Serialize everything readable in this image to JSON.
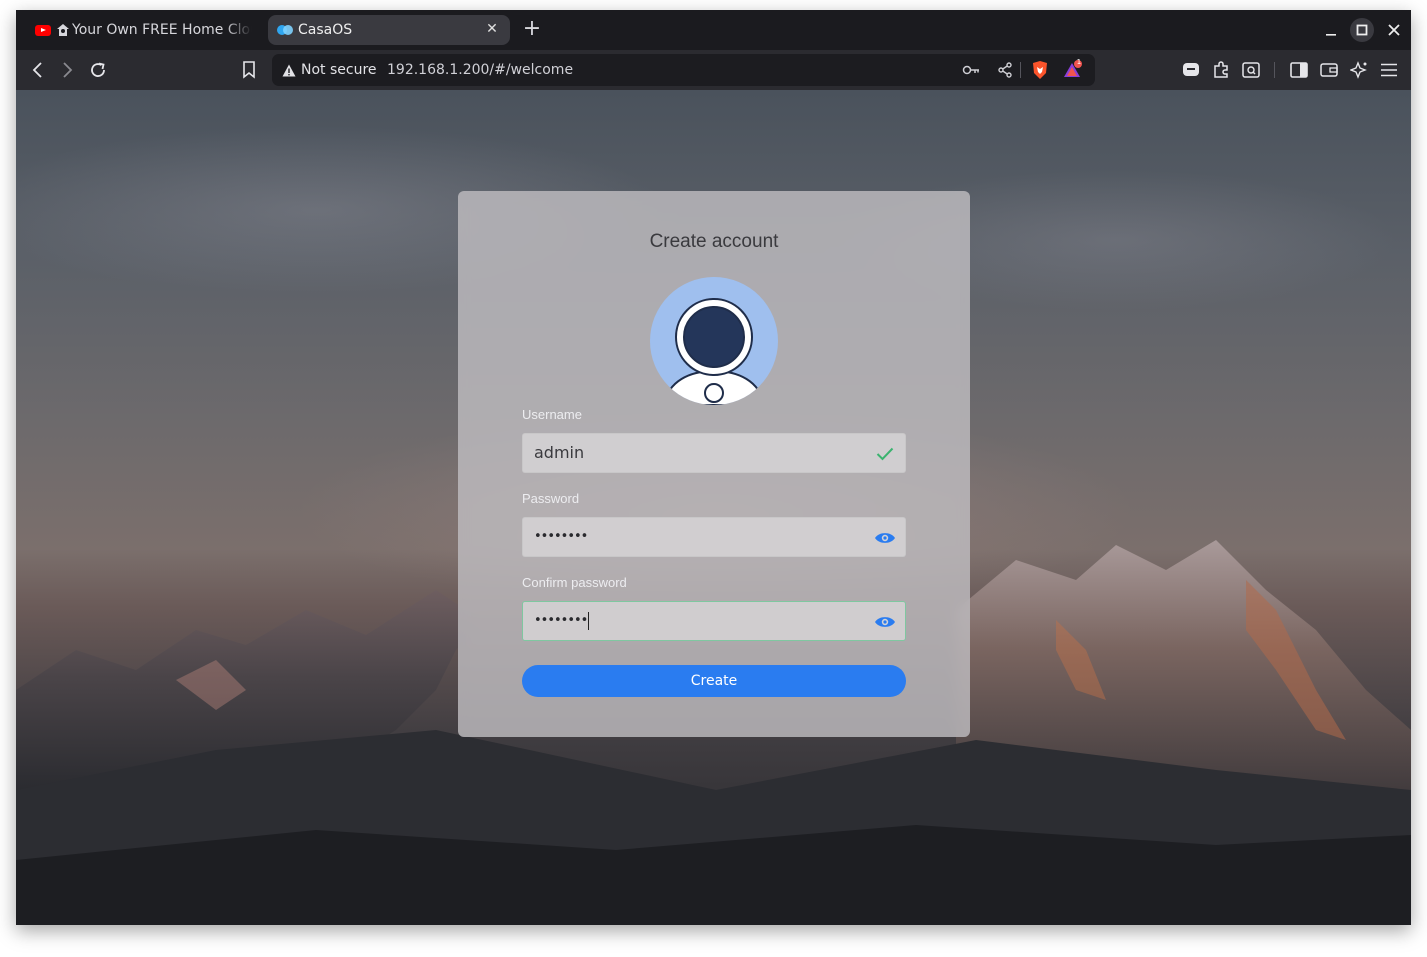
{
  "browser": {
    "tabs": [
      {
        "label": "Your Own FREE Home Cloud",
        "icon": "youtube-icon",
        "active": false
      },
      {
        "label": "CasaOS",
        "icon": "casaos-icon",
        "active": true
      }
    ],
    "new_tab_label": "+",
    "security_label": "Not secure",
    "url": "192.168.1.200/#/welcome",
    "shield_badge": "1"
  },
  "form": {
    "title": "Create account",
    "username_label": "Username",
    "username_value": "admin",
    "password_label": "Password",
    "password_value": "••••••••",
    "confirm_label": "Confirm password",
    "confirm_value": "••••••••",
    "submit_label": "Create"
  },
  "colors": {
    "accent": "#2a7cf0",
    "valid": "#3bb36f",
    "avatar_bg": "#9fbfee"
  }
}
